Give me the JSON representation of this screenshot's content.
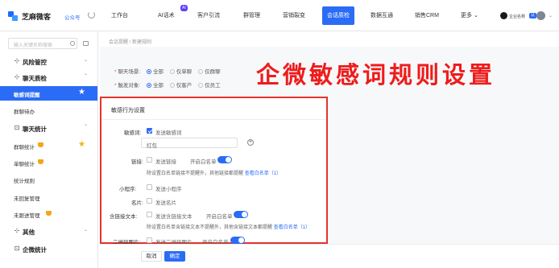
{
  "brand": {
    "name": "芝麻微客",
    "account": "公众号"
  },
  "nav": {
    "items": [
      "工作台",
      "AI话术",
      "客户引流",
      "群管理",
      "营销裂变",
      "会话质检",
      "数据互通",
      "销售CRM",
      "更多"
    ],
    "ai_badge": "AI",
    "active": "会话质检"
  },
  "user": {
    "name": "企业名称",
    "tag": "认"
  },
  "sidebar": {
    "search_placeholder": "输入关键名称搜索",
    "items": [
      {
        "label": "风险管控"
      },
      {
        "label": "聊天质检"
      },
      {
        "label": "敏感词提醒"
      },
      {
        "label": "群聊待办"
      },
      {
        "label": "聊天统计"
      },
      {
        "label": "群聊统计"
      },
      {
        "label": "单聊统计"
      },
      {
        "label": "统计规则"
      },
      {
        "label": "未回复管理"
      },
      {
        "label": "未跟进管理"
      },
      {
        "label": "其他"
      },
      {
        "label": "企微统计"
      }
    ]
  },
  "breadcrumb": "会话提醒 / 新建规则",
  "form": {
    "scene_label": "聊天场景:",
    "scene_options": [
      "全部",
      "仅单聊",
      "仅群聊"
    ],
    "target_label": "触发对象:",
    "target_options": [
      "全部",
      "仅客户",
      "仅员工"
    ]
  },
  "overlay_title": "企微敏感词规则设置",
  "section": {
    "title": "敏感行为设置",
    "sensitive_label": "敏感词:",
    "sensitive_check": "发送敏感词",
    "sensitive_word": "红包",
    "link_label": "链接:",
    "link_check": "发送链接",
    "whitelist_toggle": "开启白名单",
    "link_hint": "除设置白名单链接不提醒外，其他链接都提醒",
    "view_whitelist": "查看白名单（1）",
    "miniprogram_label": "小程序:",
    "miniprogram_check": "发送小程序",
    "card_label": "名片:",
    "card_check": "发送名片",
    "text_link_label": "含链接文本:",
    "text_link_check": "发送含链接文本",
    "text_link_hint": "除设置白名单含链接文本不提醒外，其他含链接文本都提醒",
    "qr_label": "二维码图片:",
    "qr_check": "发送二维码图片"
  },
  "footer": {
    "cancel": "取消",
    "confirm": "确定"
  },
  "colors": {
    "primary": "#2b6cf6",
    "highlight": "#ee1c1c",
    "star": "#f5b301"
  }
}
